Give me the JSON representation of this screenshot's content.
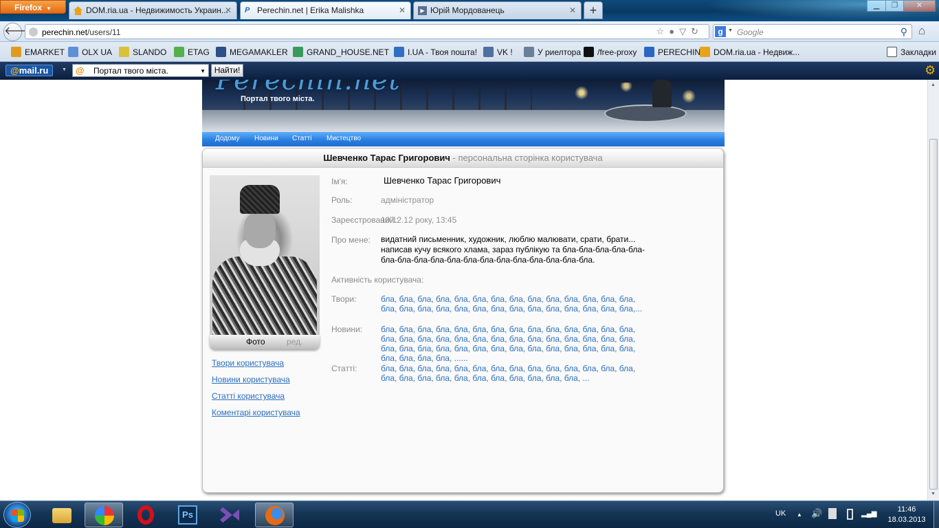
{
  "browser": {
    "firefox_label": "Firefox",
    "tabs": [
      {
        "title": "DOM.ria.ua - Недвижимость Украин...",
        "icon": "home-favicon"
      },
      {
        "title": "Perechin.net | Erika Malishka",
        "icon": "perechin-favicon"
      },
      {
        "title": "Юрій Мордованець",
        "icon": "video-favicon"
      }
    ],
    "new_tab": "+",
    "url_host": "perechin.net",
    "url_path": "/users/11",
    "search_placeholder": "Google",
    "bookmarks": [
      {
        "label": "EMARKET",
        "color": "#e09a20"
      },
      {
        "label": "OLX UA",
        "color": "#5f8fd6"
      },
      {
        "label": "SLANDO",
        "color": "#d9c23a"
      },
      {
        "label": "ETAG",
        "color": "#53b04a"
      },
      {
        "label": "MEGAMAKLER",
        "color": "#2d4e86"
      },
      {
        "label": "GRAND_HOUSE.NET",
        "color": "#3a9a5c"
      },
      {
        "label": "I.UA - Твоя пошта!",
        "color": "#2f6fc1"
      },
      {
        "label": "VK !",
        "color": "#4f6fa0"
      },
      {
        "label": "У риелтора",
        "color": "#6a7f99"
      },
      {
        "label": "/free-proxy",
        "color": "#111111"
      },
      {
        "label": "PERECHIN",
        "color": "#2a67c5"
      },
      {
        "label": "DOM.ria.ua - Недвиж...",
        "color": "#e8a21c"
      }
    ],
    "bookmarks_menu": "Закладки",
    "mailru": {
      "logo_at": "@",
      "logo_text": "mail.ru",
      "select_value": "Портал твого міста.",
      "go_button": "Найти!"
    }
  },
  "site": {
    "slogan": "Портал твого міста.",
    "logo_text": "Perechin.net",
    "menu": [
      "Додому",
      "Новини",
      "Статті",
      "Мистецтво"
    ],
    "page_title_name": "Шевченко Тарас Григорович",
    "page_title_suffix": " - персональна сторінка користувача",
    "photo": {
      "label": "Фото",
      "edit": "ред."
    },
    "user_links": [
      "Твори користувача",
      "Новини користувача",
      "Статті користувача",
      "Коментарі користувача"
    ],
    "fields": {
      "name_label": "Ім'я:",
      "name_value": "Шевченко Тарас Григорович",
      "role_label": "Роль:",
      "role_value": "адміністратор",
      "registered_label": "Зареєстрований :",
      "registered_value": "10.12.12 року, 13:45",
      "about_label": "Про мене:",
      "about_value": "видатний письменник, художник, люблю малювати, срати, брати... написав кучу всякого хлама, зараз публікую та бла-бла-бла-бла-бла-бла-бла-бла-бла-бла-бла-бла-бла-бла-бла-бла-бла-бла.",
      "activity_label": "Активність користувача:",
      "works_label": "Твори:",
      "works_value": "бла, бла, бла, бла, бла, бла, бла, бла, бла, бла, бла, бла, бла, бла, бла, бла, бла, бла, бла, бла, бла, бла, бла, бла, бла, бла, бла, бла,...",
      "news_label": "Новини:",
      "news_value": "бла, бла, бла, бла, бла, бла, бла, бла, бла, бла, бла, бла, бла, бла, бла, бла, бла, бла, бла, бла, бла, бла, бла, бла, бла, бла, бла, бла, бла, бла, бла, бла, бла, бла, бла, бла, бла, бла, бла, бла, бла, бла, бла, бла, бла, бла, ......",
      "articles_label": "Статті:",
      "articles_value": "бла, бла, бла, бла, бла, бла, бла, бла, бла, бла, бла, бла, бла, бла, бла, бла, бла, бла, бла, бла, бла, бла, бла, бла, бла, ..."
    }
  },
  "taskbar": {
    "language": "UK",
    "time": "11:46",
    "date": "18.03.2013",
    "apps": [
      "windows-explorer",
      "picasa",
      "opera",
      "photoshop",
      "visual-studio",
      "firefox"
    ]
  }
}
